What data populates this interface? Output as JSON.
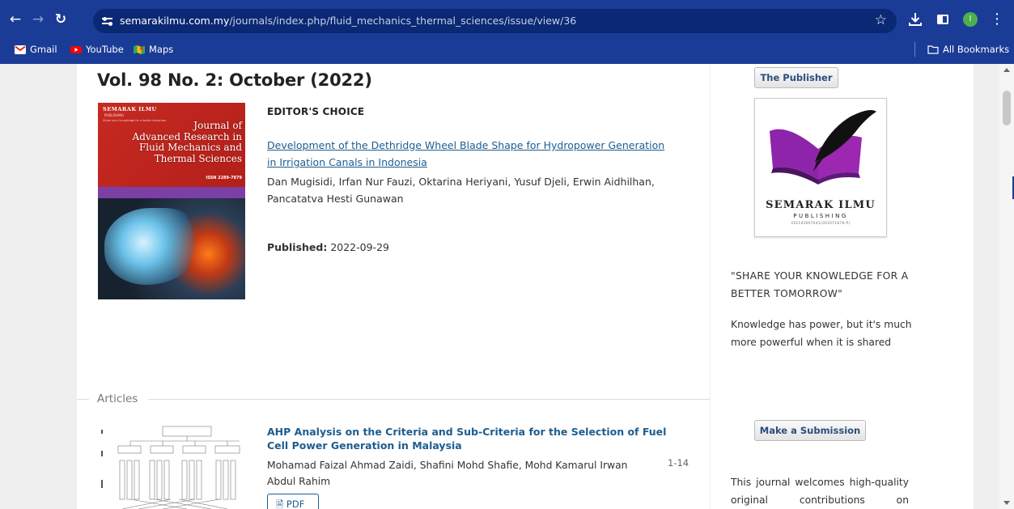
{
  "browser": {
    "url_domain": "semarakilmu.com.my",
    "url_path": "/journals/index.php/fluid_mechanics_thermal_sciences/issue/view/36",
    "profile_initial": "I",
    "bookmarks": [
      {
        "label": "Gmail",
        "icon": "gmail-icon"
      },
      {
        "label": "YouTube",
        "icon": "youtube-icon"
      },
      {
        "label": "Maps",
        "icon": "maps-icon"
      }
    ],
    "all_bookmarks": "All Bookmarks"
  },
  "issue": {
    "title": "Vol. 98 No. 2: October (2022)"
  },
  "cover": {
    "publisher": "SEMARAK ILMU",
    "publisher_sub": "PUBLISHING",
    "tagline": "Share your knowledge for a better tomorrow",
    "journal_line1": "Journal of",
    "journal_line2": "Advanced Research in",
    "journal_line3": "Fluid Mechanics and",
    "journal_line4": "Thermal Sciences",
    "issn": "ISSN 2289-7879"
  },
  "editors_choice": {
    "label": "EDITOR'S CHOICE",
    "title": "Development of the Dethridge Wheel Blade Shape for Hydropower Generation in Irrigation Canals in Indonesia",
    "authors": "Dan Mugisidi, Irfan Nur Fauzi, Oktarina Heriyani, Yusuf Djeli, Erwin Aidhilhan, Pancatatva Hesti Gunawan",
    "published_label": "Published:",
    "published_date": "2022-09-29"
  },
  "articles": {
    "heading": "Articles",
    "items": [
      {
        "title": "AHP Analysis on the Criteria and Sub-Criteria for the Selection of Fuel Cell Power Generation in Malaysia",
        "authors": "Mohamad Faizal Ahmad Zaidi, Shafini Mohd Shafie, Mohd Kamarul Irwan Abdul Rahim",
        "pages": "1-14",
        "pdf_label": "PDF"
      }
    ]
  },
  "sidebar": {
    "publisher_button": "The Publisher",
    "logo_name": "SEMARAK ILMU",
    "logo_sub": "PUBLISHING",
    "logo_tiny": "202103007041(002071878-P)",
    "slogan": "\"SHARE YOUR KNOWLEDGE FOR A BETTER TOMORROW\"",
    "slogan2": "Knowledge has power, but it's much more powerful when it is shared",
    "submission_button": "Make a Submission",
    "welcome": "This journal welcomes high-quality original contributions on"
  },
  "colors": {
    "chrome": "#1b3c96",
    "link": "#1d5d8f",
    "logo_purple": "#8e24aa"
  }
}
